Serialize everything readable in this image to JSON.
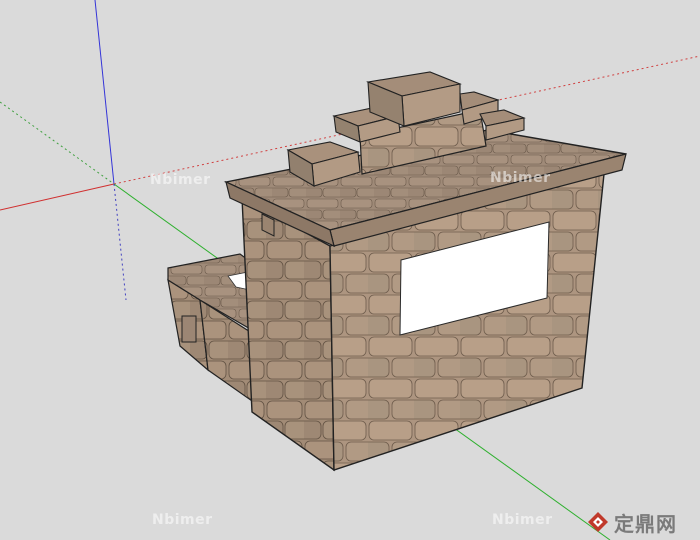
{
  "watermark": {
    "text": "Nbimer"
  },
  "logo": {
    "text": "定鼎网",
    "icon": "diamond-logo-icon",
    "color": "#c0392b"
  },
  "colors": {
    "background": "#dadada",
    "axis_red": "#d03030",
    "axis_green": "#30b030",
    "axis_blue": "#3030d0",
    "stone_light": "#b49a82",
    "stone_dark": "#8f7a66",
    "opening": "#ffffff"
  }
}
